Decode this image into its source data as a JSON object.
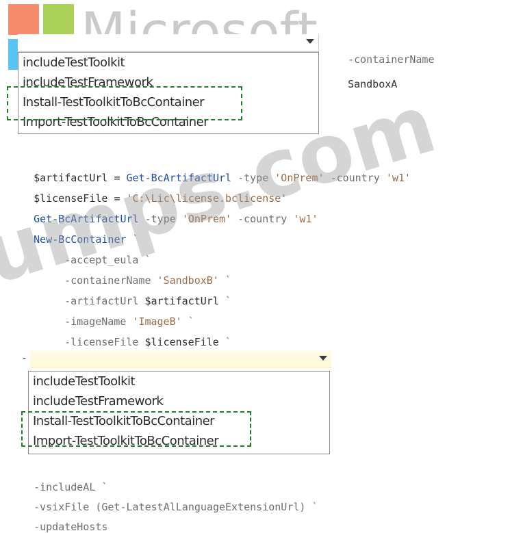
{
  "watermark": {
    "brand_text": "Microsoft",
    "dumps_text": "umps.com"
  },
  "top_snippet": {
    "suffix_param": "-containerName",
    "suffix_value": "SandboxA"
  },
  "dropdown_top": {
    "items": [
      "includeTestToolkit",
      "includeTestFramework",
      "Install-TestToolkitToBcContainer",
      "Import-TestToolkitToBcContainer"
    ]
  },
  "script": {
    "line1_var": "$artifactUrl",
    "line1_op": " = ",
    "line1_cmd": "Get-BcArtifactUrl",
    "line1_p1": " -type ",
    "line1_v1": "'OnPrem'",
    "line1_p2": " -country ",
    "line1_v2": "'w1'",
    "line2_var": "$licenseFile",
    "line2_op": " = ",
    "line2_v": "'C:\\Lic\\license.bclicense'",
    "line3_cmd": "Get-BcArtifactUrl",
    "line3_p1": " -type ",
    "line3_v1": "'OnPrem'",
    "line3_p2": " -country ",
    "line3_v2": "'w1'",
    "line4_cmd": "New-BcContainer",
    "line4_tick": " `",
    "line5_param": "-accept_eula",
    "line5_tick": " `",
    "line6_param": "-containerName",
    "line6_value": " 'SandboxB'",
    "line6_tick": " `",
    "line7_param": "-artifactUrl",
    "line7_value": " $artifactUrl",
    "line7_tick": " `",
    "line8_param": "-imageName",
    "line8_value": " 'ImageB'",
    "line8_tick": " `",
    "line9_param": "-licenseFile",
    "line9_value": " $licenseFile",
    "line9_tick": " `",
    "dash_mark": "-",
    "line10_param": "-includeAL",
    "line10_tick": " `",
    "line11_param": "-vsixFile",
    "line11_value": " (Get-LatestAlLanguageExtensionUrl)",
    "line11_tick": " `",
    "line12_param": "-updateHosts"
  },
  "dropdown_bottom": {
    "items": [
      "includeTestToolkit",
      "includeTestFramework",
      "Install-TestToolkitToBcContainer",
      "Import-TestToolkitToBcContainer"
    ]
  },
  "colors": {
    "keyword": "#1f4fa3",
    "param": "#6e6e6e",
    "string": "#9a6b47",
    "dashed_highlight": "#1f7d2a"
  }
}
